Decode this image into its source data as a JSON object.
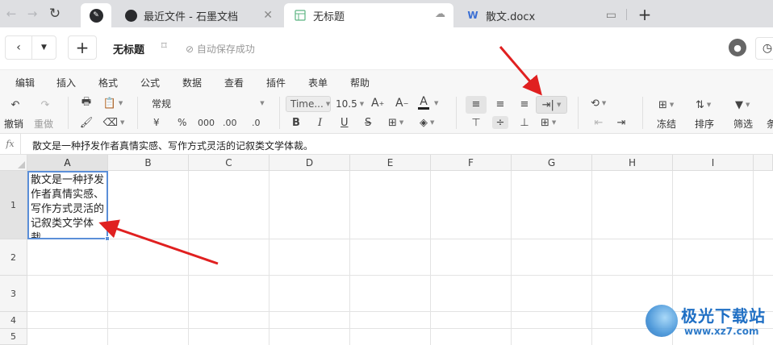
{
  "browser": {
    "tabs": [
      {
        "title": "最近文件 - 石墨文档",
        "icon": "shimo-logo-icon"
      },
      {
        "title": "无标题",
        "icon": "spreadsheet-icon",
        "active": true
      },
      {
        "title": "散文.docx",
        "icon": "word-doc-icon"
      }
    ],
    "new_tab_label": "+"
  },
  "header": {
    "doc_title": "无标题",
    "autosave_text": "自动保存成功"
  },
  "menu": [
    "编辑",
    "插入",
    "格式",
    "公式",
    "数据",
    "查看",
    "插件",
    "表单",
    "帮助"
  ],
  "toolbar": {
    "undo_label": "撤销",
    "redo_label": "重做",
    "number_format": "常规",
    "currency_symbol": "¥",
    "percent_symbol": "%",
    "thousands_label": "000",
    "decimal_increase_label": ".00",
    "decimal_decrease_label": ".0",
    "font_name": "Time...",
    "font_size": "10.5",
    "freeze_label": "冻结",
    "sort_label": "排序",
    "filter_label": "筛选",
    "condition_label": "条"
  },
  "formula_bar": {
    "fx_label": "fx",
    "content": "散文是一种抒发作者真情实感、写作方式灵活的记叙类文学体裁。"
  },
  "sheet": {
    "columns": [
      "A",
      "B",
      "C",
      "D",
      "E",
      "F",
      "G",
      "H",
      "I"
    ],
    "rows": [
      "1",
      "2",
      "3",
      "4",
      "5"
    ],
    "cell_A1": "散文是一种抒发作者真情实感、写作方式灵活的记叙类文学体裁。",
    "selected_cell": "A1"
  },
  "watermark": {
    "title": "极光下载站",
    "url": "www.xz7.com"
  },
  "colors": {
    "tabbar_bg": "#dedfe2",
    "selection_border": "#5b8fd8",
    "annotation_arrow": "#e02020"
  }
}
